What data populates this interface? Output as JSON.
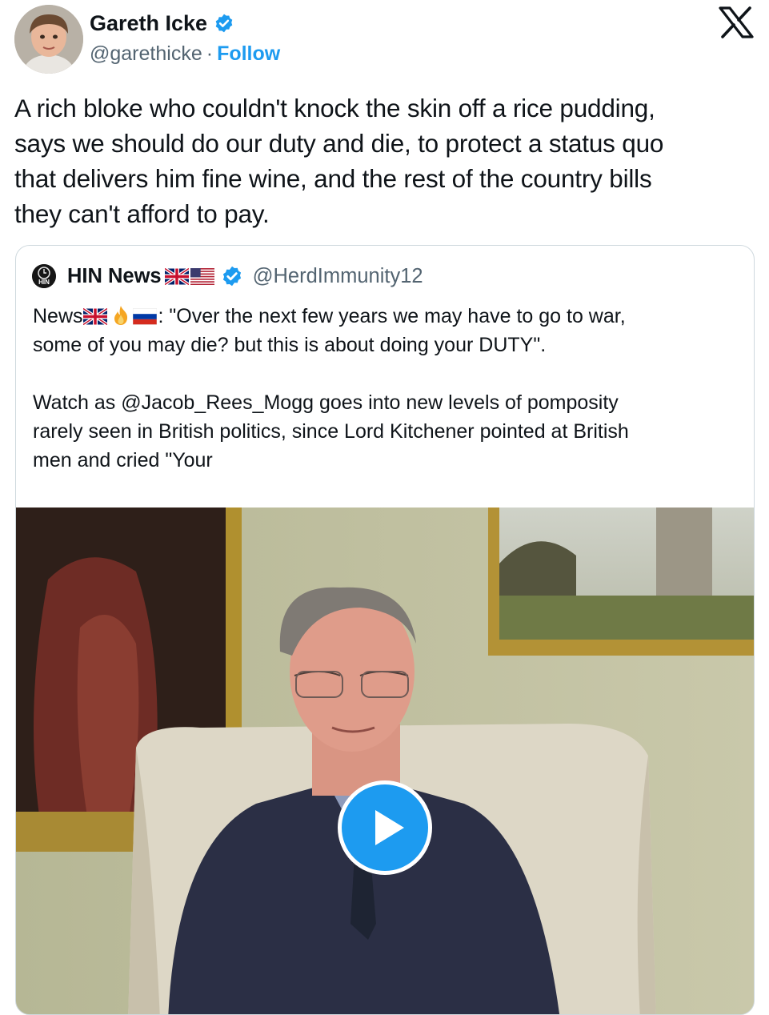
{
  "author": {
    "name": "Gareth Icke",
    "handle": "@garethicke",
    "separator": "·",
    "follow_label": "Follow"
  },
  "tweet": {
    "lines": [
      "A rich bloke who couldn't knock the skin off a rice pudding,",
      "says we should do our duty and die, to protect a status quo",
      "that delivers him fine wine, and the rest of the country bills",
      "they can't afford to pay."
    ]
  },
  "quote": {
    "name": "HIN News",
    "handle": "@HerdImmunity12",
    "avatar_text": "HIN",
    "text_prefix": "News",
    "text_line1_rest": ": \"Over the next few years we may have to go to war,",
    "text_line2": "some of you may die? but this is about doing your DUTY\".",
    "text_para2": [
      "Watch as @Jacob_Rees_Mogg goes into new levels of pomposity",
      "rarely seen in British politics, since Lord Kitchener pointed at British",
      "men and cried \"Your"
    ]
  },
  "icons": [
    "verified-badge-icon",
    "x-logo-icon",
    "uk-flag-icon",
    "us-flag-icon",
    "fire-icon",
    "russia-flag-icon",
    "play-icon"
  ],
  "colors": {
    "accent": "#1d9bf0",
    "text": "#0f1419",
    "secondary": "#536471",
    "border": "#cfd9de"
  }
}
